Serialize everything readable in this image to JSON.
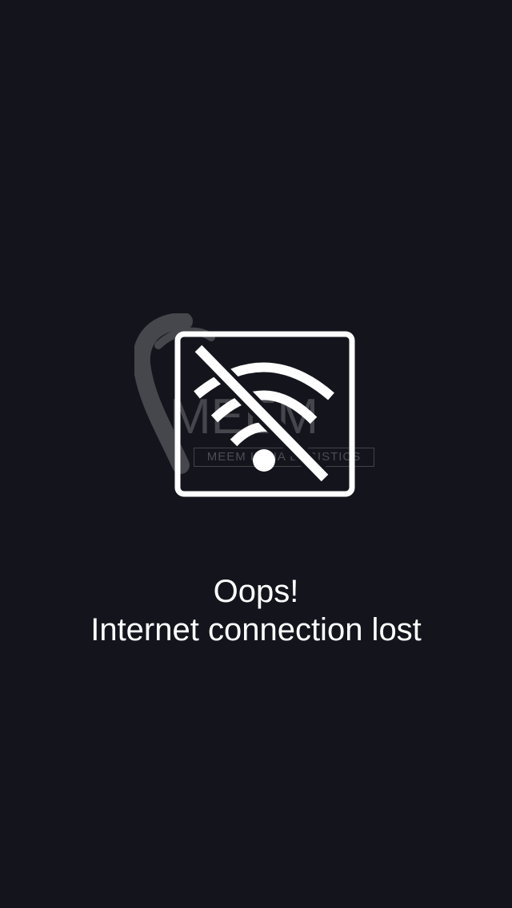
{
  "error": {
    "title": "Oops!",
    "message": "Internet connection lost",
    "icon": "no-wifi-icon"
  },
  "watermark": {
    "brand": "MEEM",
    "tagline": "MEEM INDIA LOGISTICS"
  },
  "colors": {
    "background": "#14151c",
    "foreground": "#ffffff",
    "watermark": "#6f6f75"
  }
}
